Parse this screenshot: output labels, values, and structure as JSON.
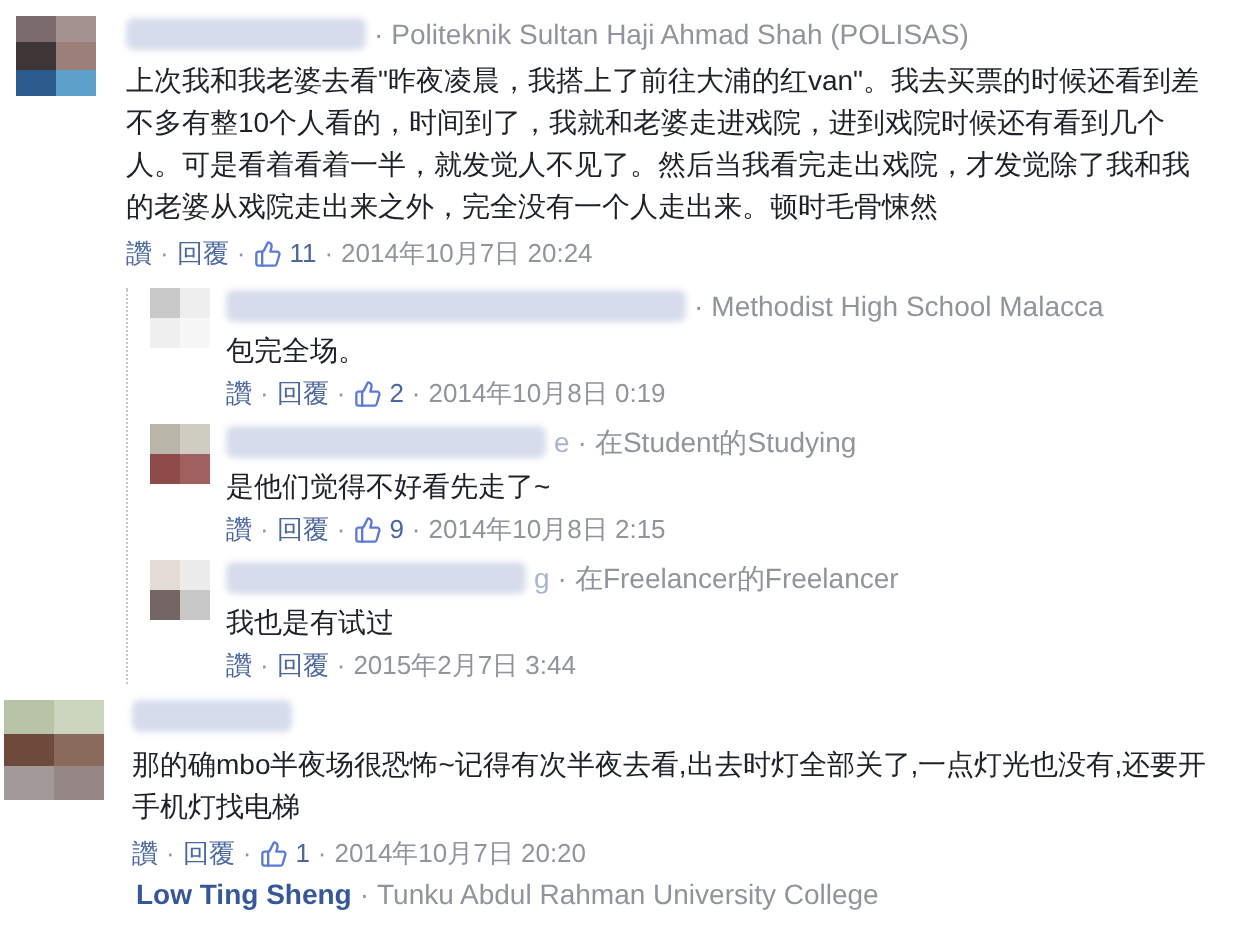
{
  "separator": "·",
  "comments": [
    {
      "affiliation": "Politeknik Sultan Haji Ahmad Shah (POLISAS)",
      "body": "上次我和我老婆去看\"昨夜凌晨，我搭上了前往大浦的红van\"。我去买票的时候还看到差不多有整10个人看的，时间到了，我就和老婆走进戏院，进到戏院时候还有看到几个人。可是看着看着一半，就发觉人不见了。然后当我看完走出戏院，才发觉除了我和我的老婆从戏院走出来之外，完全没有一个人走出来。顿时毛骨悚然",
      "like": "讚",
      "reply": "回覆",
      "likes": "11",
      "time": "2014年10月7日 20:24",
      "replies": [
        {
          "affiliation": "Methodist High School Malacca",
          "body": "包完全场。",
          "like": "讚",
          "reply": "回覆",
          "likes": "2",
          "time": "2014年10月8日 0:19"
        },
        {
          "name_tail": "e",
          "affiliation": "在Student的Studying",
          "body": "是他们觉得不好看先走了~",
          "like": "讚",
          "reply": "回覆",
          "likes": "9",
          "time": "2014年10月8日 2:15"
        },
        {
          "name_tail": "g",
          "affiliation": "在Freelancer的Freelancer",
          "body": "我也是有试过",
          "like": "讚",
          "reply": "回覆",
          "time": "2015年2月7日 3:44"
        }
      ]
    },
    {
      "body": "那的确mbo半夜场很恐怖~记得有次半夜去看,出去时灯全部关了,一点灯光也没有,还要开手机灯找电梯",
      "like": "讚",
      "reply": "回覆",
      "likes": "1",
      "time": "2014年10月7日 20:20"
    },
    {
      "name": "Low Ting Sheng",
      "affiliation": "Tunku Abdul Rahman University College"
    }
  ]
}
